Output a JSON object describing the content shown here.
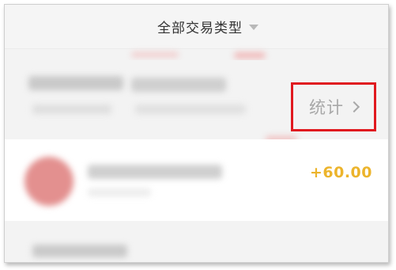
{
  "header": {
    "filter_label": "全部交易类型",
    "dropdown_icon": "caret-down-icon"
  },
  "summary": {
    "stats_label": "统计",
    "stats_icon": "chevron-right-icon",
    "highlight_color": "#e0191f"
  },
  "transactions": [
    {
      "amount": "+60.00",
      "avatar_icon": "merchant-avatar-icon",
      "amount_color": "#ecb42c"
    }
  ]
}
